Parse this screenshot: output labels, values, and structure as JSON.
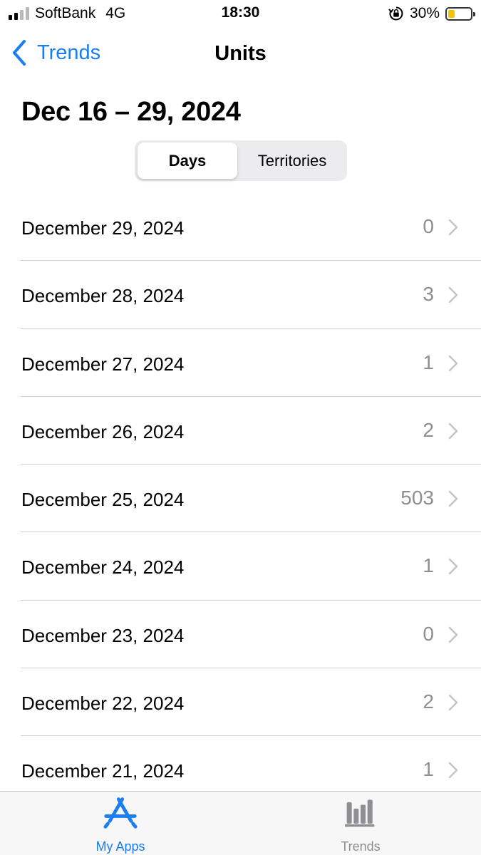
{
  "status_bar": {
    "carrier": "SoftBank",
    "network": "4G",
    "time": "18:30",
    "battery_percent": "30%",
    "battery_level": 0.3,
    "signal_bars_active": 2,
    "signal_bars_total": 4,
    "icons": [
      "signal-icon",
      "orientation-lock-icon",
      "battery-icon"
    ]
  },
  "nav": {
    "back_label": "Trends",
    "title": "Units",
    "back_icon": "chevron-left-icon"
  },
  "header": {
    "range_title": "Dec 16 – 29, 2024"
  },
  "segments": {
    "days": "Days",
    "territories": "Territories",
    "selected": "Days"
  },
  "rows": [
    {
      "date": "December 29, 2024",
      "value": "0"
    },
    {
      "date": "December 28, 2024",
      "value": "3"
    },
    {
      "date": "December 27, 2024",
      "value": "1"
    },
    {
      "date": "December 26, 2024",
      "value": "2"
    },
    {
      "date": "December 25, 2024",
      "value": "503"
    },
    {
      "date": "December 24, 2024",
      "value": "1"
    },
    {
      "date": "December 23, 2024",
      "value": "0"
    },
    {
      "date": "December 22, 2024",
      "value": "2"
    },
    {
      "date": "December 21, 2024",
      "value": "1"
    }
  ],
  "tabs": {
    "my_apps": "My Apps",
    "trends": "Trends",
    "selected": "My Apps",
    "icons": [
      "app-store-icon",
      "bar-chart-icon"
    ]
  },
  "colors": {
    "accent": "#1a7ef0",
    "secondary_text": "#8e8e93",
    "battery_fill": "#f5c400"
  }
}
